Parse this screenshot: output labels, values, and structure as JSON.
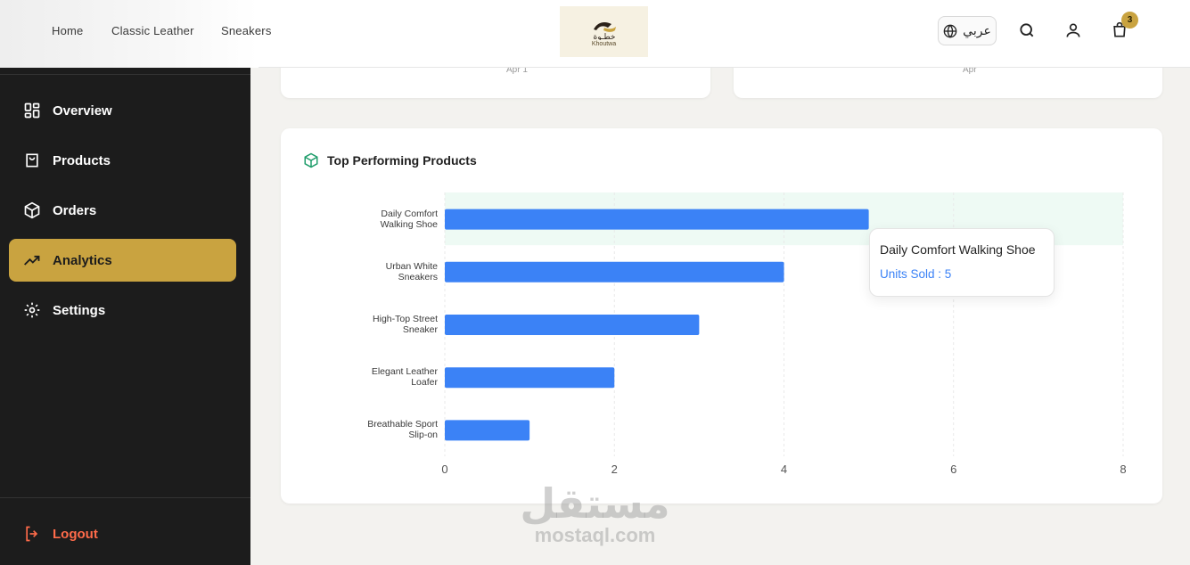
{
  "nav": {
    "links": [
      "Home",
      "Classic Leather",
      "Sneakers"
    ],
    "logo_text": "خطـوة",
    "logo_caption": "Khoutwa",
    "lang_label": "عربي",
    "cart_count": "3"
  },
  "sidebar": {
    "items": [
      {
        "label": "Overview",
        "icon": "grid-icon"
      },
      {
        "label": "Products",
        "icon": "shopping-bag-icon"
      },
      {
        "label": "Orders",
        "icon": "package-icon"
      },
      {
        "label": "Analytics",
        "icon": "trending-up-icon"
      },
      {
        "label": "Settings",
        "icon": "gear-icon"
      }
    ],
    "active": "Analytics",
    "logout_label": "Logout"
  },
  "top_cards": {
    "left_tick": "Apr 1",
    "right_tick": "Apr"
  },
  "chart_card": {
    "title": "Top Performing Products",
    "icon": "box-icon"
  },
  "chart_data": {
    "type": "bar",
    "orientation": "horizontal",
    "categories": [
      "Daily Comfort Walking Shoe",
      "Urban White Sneakers",
      "High-Top Street Sneaker",
      "Elegant Leather Loafer",
      "Breathable Sport Slip-on"
    ],
    "category_lines": [
      [
        "Daily Comfort",
        "Walking Shoe"
      ],
      [
        "Urban White",
        "Sneakers"
      ],
      [
        "High-Top Street",
        "Sneaker"
      ],
      [
        "Elegant Leather",
        "Loafer"
      ],
      [
        "Breathable Sport",
        "Slip-on"
      ]
    ],
    "series": [
      {
        "name": "Units Sold",
        "values": [
          5,
          4,
          3,
          2,
          1
        ]
      }
    ],
    "xlim": [
      0,
      8
    ],
    "xticks": [
      "0",
      "2",
      "4",
      "6",
      "8"
    ],
    "grid": true,
    "bar_color": "#3b82f6",
    "highlight_color": "#eefaf4"
  },
  "tooltip": {
    "title": "Daily Comfort Walking Shoe",
    "value_text": "Units Sold : 5"
  },
  "watermark": {
    "arabic": "مستقل",
    "domain": "mostaql.com"
  }
}
